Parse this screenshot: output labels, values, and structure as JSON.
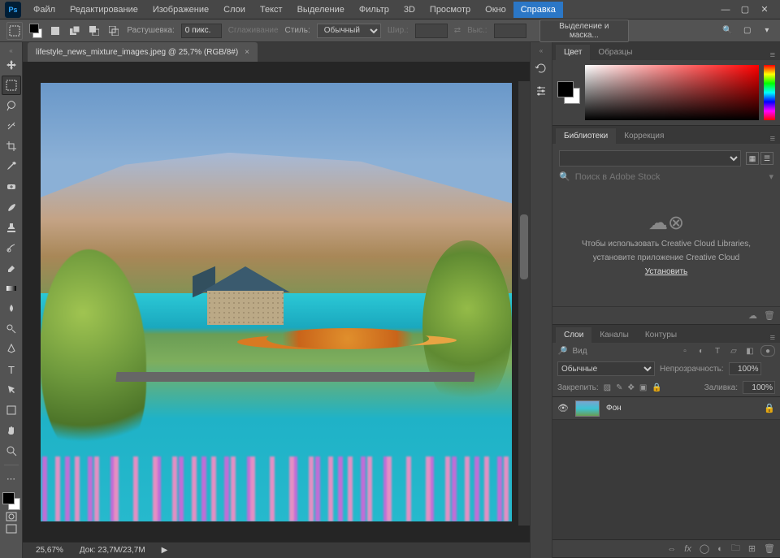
{
  "app_logo": "Ps",
  "menu": [
    "Файл",
    "Редактирование",
    "Изображение",
    "Слои",
    "Текст",
    "Выделение",
    "Фильтр",
    "3D",
    "Просмотр",
    "Окно",
    "Справка"
  ],
  "menu_active_index": 10,
  "options": {
    "feather_label": "Растушевка:",
    "feather_value": "0 пикс.",
    "antialias": "Сглаживание",
    "style_label": "Стиль:",
    "style_value": "Обычный",
    "width_label": "Шир.:",
    "height_label": "Выс.:",
    "mask_button": "Выделение и маска..."
  },
  "document": {
    "tab_title": "lifestyle_news_mixture_images.jpeg @ 25,7% (RGB/8#)"
  },
  "status": {
    "zoom": "25,67%",
    "doc_size": "Док: 23,7M/23,7M"
  },
  "panels": {
    "color_tabs": [
      "Цвет",
      "Образцы"
    ],
    "lib_tabs": [
      "Библиотеки",
      "Коррекция"
    ],
    "lib_search_placeholder": "Поиск в Adobe Stock",
    "lib_empty_line1": "Чтобы использовать Creative Cloud Libraries,",
    "lib_empty_line2": "установите приложение Creative Cloud",
    "lib_install": "Установить",
    "layer_tabs": [
      "Слои",
      "Каналы",
      "Контуры"
    ],
    "layer_filter_label": "Вид",
    "blend_mode": "Обычные",
    "opacity_label": "Непрозрачность:",
    "opacity_value": "100%",
    "lock_label": "Закрепить:",
    "fill_label": "Заливка:",
    "fill_value": "100%",
    "layer_name": "Фон"
  }
}
